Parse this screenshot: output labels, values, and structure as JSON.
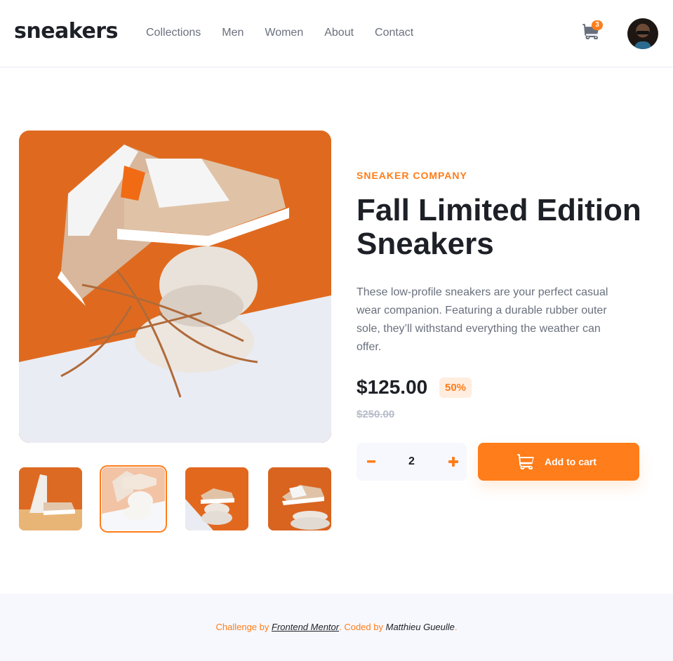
{
  "brand": {
    "logo": "sneakers",
    "accent": "#ff7d1a"
  },
  "nav": {
    "items": [
      "Collections",
      "Men",
      "Women",
      "About",
      "Contact"
    ]
  },
  "cart": {
    "count": "3",
    "icon": "cart-icon"
  },
  "user": {
    "avatar_icon": "avatar"
  },
  "gallery": {
    "main_image": "sneaker-on-stones-orange-background",
    "thumbnails": [
      "thumbnail-1",
      "thumbnail-2",
      "thumbnail-3",
      "thumbnail-4"
    ],
    "active_index": 1
  },
  "product": {
    "company": "SNEAKER COMPANY",
    "title": "Fall Limited Edition Sneakers",
    "description": "These low-profile sneakers are your perfect casual wear companion. Featuring a durable rubber outer sole, they’ll withstand everything the weather can offer.",
    "price": "$125.00",
    "discount": "50%",
    "old_price": "$250.00"
  },
  "quantity": {
    "value": "2"
  },
  "actions": {
    "add_to_cart": "Add to cart"
  },
  "footer": {
    "challenge_by": "Challenge by",
    "challenge_link": "Frontend Mentor",
    "coded_by": ". Coded by",
    "author": "Matthieu Gueulle",
    "period": "."
  }
}
